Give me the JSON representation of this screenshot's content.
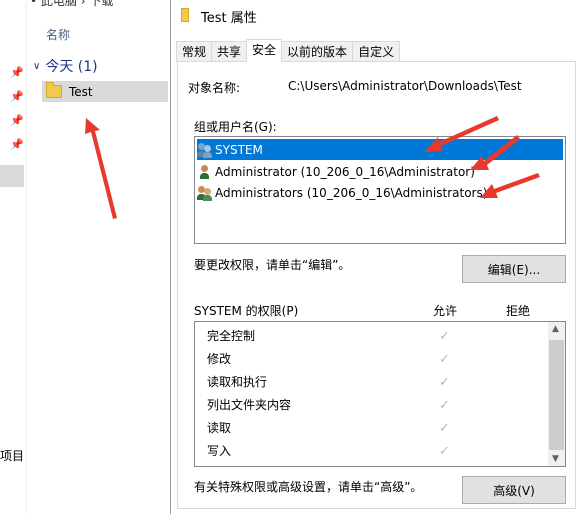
{
  "explorer": {
    "breadcrumb": "• 此电脑 › 下载",
    "column_name": "名称",
    "group": {
      "label": "今天 (1)"
    },
    "file": {
      "name": "Test"
    },
    "nav_bottom_label": "项目",
    "pin_icons": [
      "pin-icon",
      "pin-icon",
      "pin-icon",
      "pin-icon"
    ]
  },
  "dialog": {
    "title": "Test 属性",
    "tabs": [
      {
        "label": "常规"
      },
      {
        "label": "共享"
      },
      {
        "label": "安全"
      },
      {
        "label": "以前的版本"
      },
      {
        "label": "自定义"
      }
    ],
    "active_tab": "安全",
    "object_name_label": "对象名称:",
    "object_name_value": "C:\\Users\\Administrator\\Downloads\\Test",
    "groups_label": "组或用户名(G):",
    "users": [
      {
        "name": "SYSTEM",
        "selected": true
      },
      {
        "name": "Administrator (10_206_0_16\\Administrator)",
        "selected": false
      },
      {
        "name": "Administrators (10_206_0_16\\Administrators)",
        "selected": false
      }
    ],
    "change_hint": "要更改权限，请单击“编辑”。",
    "edit_button": "编辑(E)...",
    "permissions_label": "SYSTEM 的权限(P)",
    "allow_header": "允许",
    "deny_header": "拒绝",
    "permissions": [
      {
        "name": "完全控制",
        "allow": "✓"
      },
      {
        "name": "修改",
        "allow": "✓"
      },
      {
        "name": "读取和执行",
        "allow": "✓"
      },
      {
        "name": "列出文件夹内容",
        "allow": "✓"
      },
      {
        "name": "读取",
        "allow": "✓"
      },
      {
        "name": "写入",
        "allow": "✓"
      }
    ],
    "advanced_hint": "有关特殊权限或高级设置，请单击“高级”。",
    "advanced_button": "高级(V)"
  },
  "colors": {
    "selection": "#0078d7",
    "annotation_arrow": "#e8392e",
    "group_header": "#1e3287"
  }
}
